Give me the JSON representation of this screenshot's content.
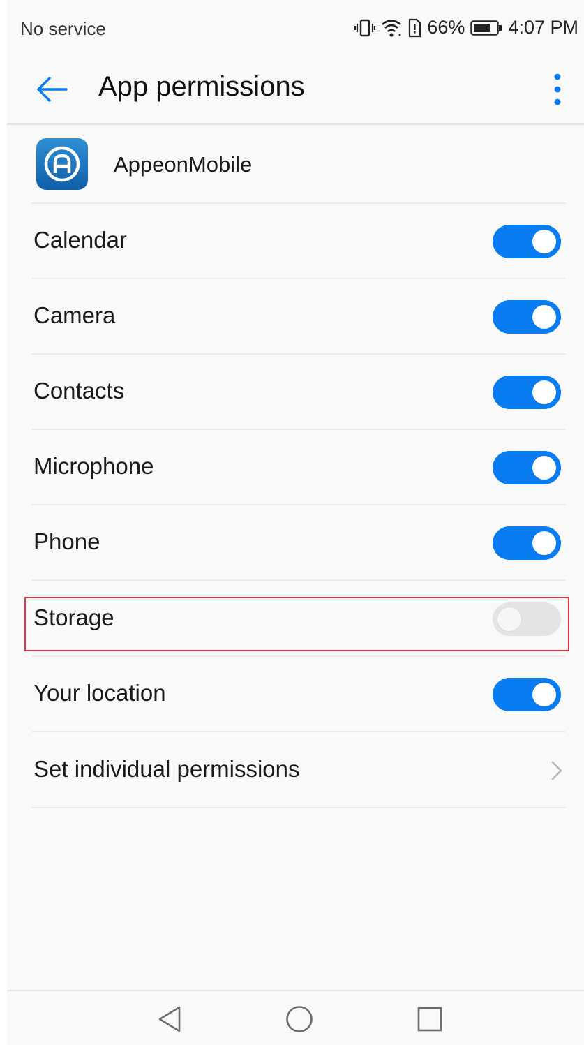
{
  "status_bar": {
    "carrier": "No service",
    "battery_percent": "66%",
    "time": "4:07 PM",
    "icons": [
      "vibrate-icon",
      "wifi-icon",
      "sim-alert-icon",
      "battery-icon"
    ]
  },
  "app_bar": {
    "title": "App permissions",
    "back_icon": "arrow-left-icon",
    "more_icon": "more-vertical-icon"
  },
  "app": {
    "name": "AppeonMobile",
    "icon": "appeon-logo-icon"
  },
  "permissions": [
    {
      "label": "Calendar",
      "enabled": true
    },
    {
      "label": "Camera",
      "enabled": true
    },
    {
      "label": "Contacts",
      "enabled": true
    },
    {
      "label": "Microphone",
      "enabled": true
    },
    {
      "label": "Phone",
      "enabled": true
    },
    {
      "label": "Storage",
      "enabled": false
    },
    {
      "label": "Your location",
      "enabled": true
    }
  ],
  "individual": {
    "label": "Set individual permissions",
    "icon": "chevron-right-icon"
  },
  "nav_bar": {
    "icons": [
      "nav-back-icon",
      "nav-home-icon",
      "nav-recents-icon"
    ]
  },
  "colors": {
    "accent": "#0a7cf2",
    "toggle_off": "#e4e4e4",
    "highlight": "#e0353f",
    "background": "#f9f9f9"
  }
}
